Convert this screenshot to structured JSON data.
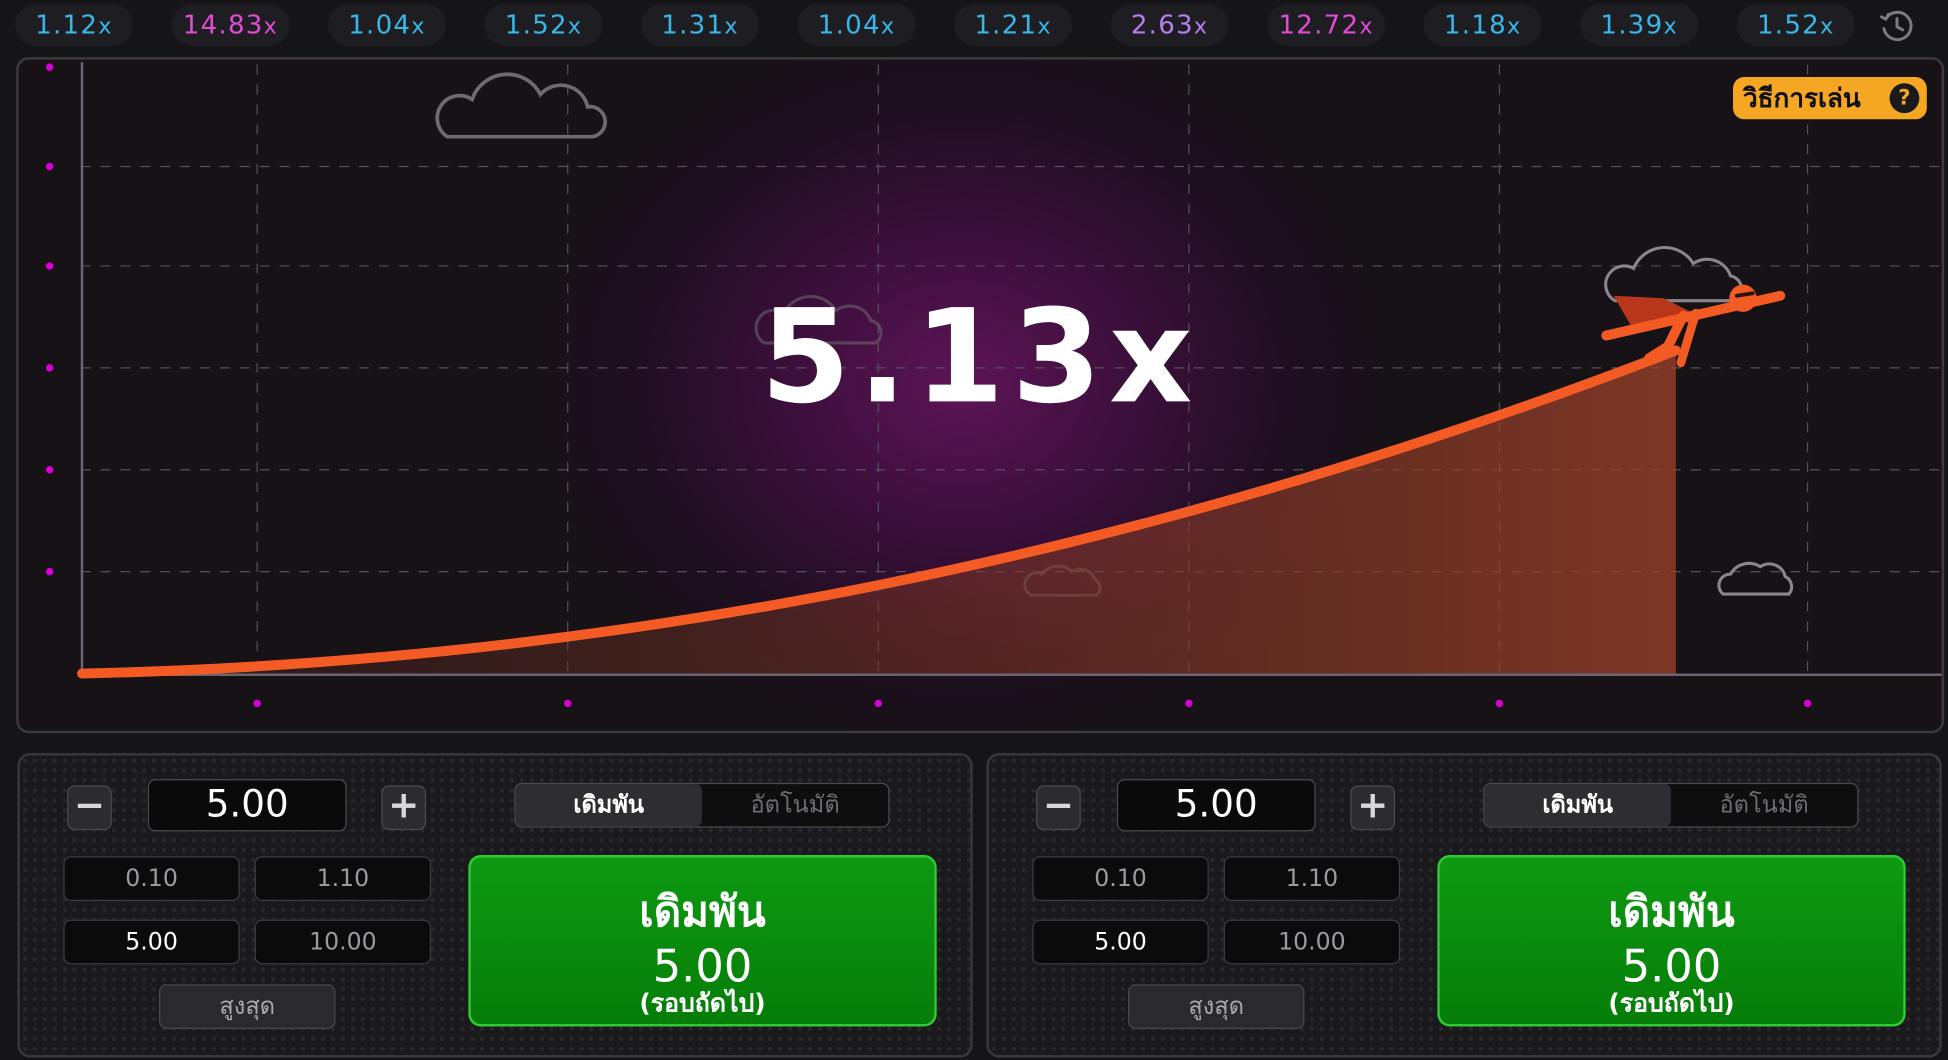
{
  "history": [
    {
      "value": "1.12",
      "suffix": "x",
      "color": "#38b6e8"
    },
    {
      "value": "14.83",
      "suffix": "x",
      "color": "#e04bd6"
    },
    {
      "value": "1.04",
      "suffix": "x",
      "color": "#38b6e8"
    },
    {
      "value": "1.52",
      "suffix": "x",
      "color": "#38b6e8"
    },
    {
      "value": "1.31",
      "suffix": "x",
      "color": "#38b6e8"
    },
    {
      "value": "1.04",
      "suffix": "x",
      "color": "#38b6e8"
    },
    {
      "value": "1.21",
      "suffix": "x",
      "color": "#38b6e8"
    },
    {
      "value": "2.63",
      "suffix": "x",
      "color": "#b77cf0"
    },
    {
      "value": "12.72",
      "suffix": "x",
      "color": "#e04bd6"
    },
    {
      "value": "1.18",
      "suffix": "x",
      "color": "#38b6e8"
    },
    {
      "value": "1.39",
      "suffix": "x",
      "color": "#38b6e8"
    },
    {
      "value": "1.52",
      "suffix": "x",
      "color": "#38b6e8"
    }
  ],
  "history_icon": "clock-history-icon",
  "game": {
    "multiplier": "5.13x",
    "how_to_play": "วิธีการเล่น",
    "how_to_icon": "?",
    "curve_color": "#f35a24",
    "axis_dot_color": "#d400d4"
  },
  "panels": [
    {
      "minus": "−",
      "plus": "+",
      "amount": "5.00",
      "tab_bet": "เดิมพัน",
      "tab_auto": "อัตโนมัติ",
      "chips": [
        "0.10",
        "1.10",
        "5.00",
        "10.00"
      ],
      "selected_chip": 2,
      "max_label": "สูงสุด",
      "bet_title": "เดิมพัน",
      "bet_amount": "5.00",
      "bet_note": "(รอบถัดไป)"
    },
    {
      "minus": "−",
      "plus": "+",
      "amount": "5.00",
      "tab_bet": "เดิมพัน",
      "tab_auto": "อัตโนมัติ",
      "chips": [
        "0.10",
        "1.10",
        "5.00",
        "10.00"
      ],
      "selected_chip": 2,
      "max_label": "สูงสุด",
      "bet_title": "เดิมพัน",
      "bet_amount": "5.00",
      "bet_note": "(รอบถัดไป)"
    }
  ]
}
